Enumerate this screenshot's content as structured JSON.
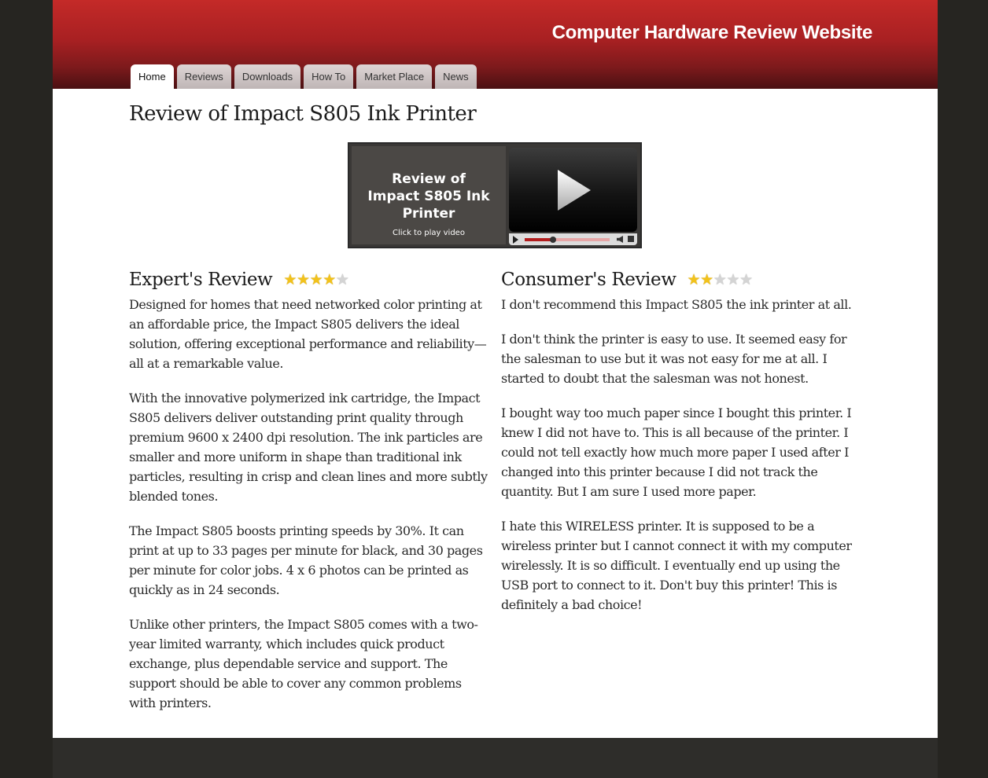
{
  "site": {
    "title": "Computer Hardware Review Website"
  },
  "nav": {
    "tabs": [
      {
        "label": "Home",
        "active": true
      },
      {
        "label": "Reviews",
        "active": false
      },
      {
        "label": "Downloads",
        "active": false
      },
      {
        "label": "How To",
        "active": false
      },
      {
        "label": "Market Place",
        "active": false
      },
      {
        "label": "News",
        "active": false
      }
    ]
  },
  "page": {
    "title": "Review of Impact S805 Ink Printer"
  },
  "video": {
    "title": "Review of Impact S805  Ink Printer",
    "subtitle": "Click to play video",
    "progress": 0.33
  },
  "expert_review": {
    "heading": "Expert's Review",
    "rating": 4,
    "max_rating": 5,
    "paragraphs": [
      "Designed for homes that need networked color printing at an affordable price, the Impact S805 delivers the ideal solution, offering exceptional performance and reliability—all at a remarkable value.",
      "With the innovative polymerized ink cartridge, the Impact S805 delivers deliver outstanding print quality through premium 9600 x 2400 dpi resolution. The ink particles are smaller and more uniform in shape than traditional ink particles, resulting in crisp and clean lines and more subtly blended tones.",
      "The Impact S805 boosts printing speeds by 30%. It can print at up to 33 pages per minute for black, and 30 pages per minute for color jobs. 4 x 6 photos can be printed as quickly as in 24 seconds.",
      "Unlike other printers, the Impact S805 comes with a two-year limited warranty, which includes quick product exchange, plus dependable service and support. The support should be able to cover any common problems with printers."
    ]
  },
  "consumer_review": {
    "heading": "Consumer's Review",
    "rating": 2,
    "max_rating": 5,
    "paragraphs": [
      "I don't recommend this Impact S805 the ink printer at all.",
      "I don't think the printer is easy to use. It seemed easy for the salesman to use but it was not easy for me at all. I started to doubt that the salesman was not honest.",
      "I bought way too much paper since I bought this printer. I knew I did not have to. This is all because of the printer. I could not tell exactly how much more paper I used after I changed into this printer because I did not track the quantity. But I am sure I used more paper.",
      "I hate this WIRELESS printer. It is supposed to be a wireless printer but I cannot connect it with my computer wirelessly. It is so difficult. I eventually end up using the USB port to connect to it. Don't buy this printer! This is definitely a bad choice!"
    ]
  },
  "colors": {
    "header_red": "#c42a28",
    "star_on": "#f2c21b",
    "star_off": "#d4d4d4",
    "background": "#262521"
  },
  "icons": {
    "play": "play-icon",
    "star": "star-icon",
    "volume": "volume-icon",
    "stop": "stop-icon"
  }
}
